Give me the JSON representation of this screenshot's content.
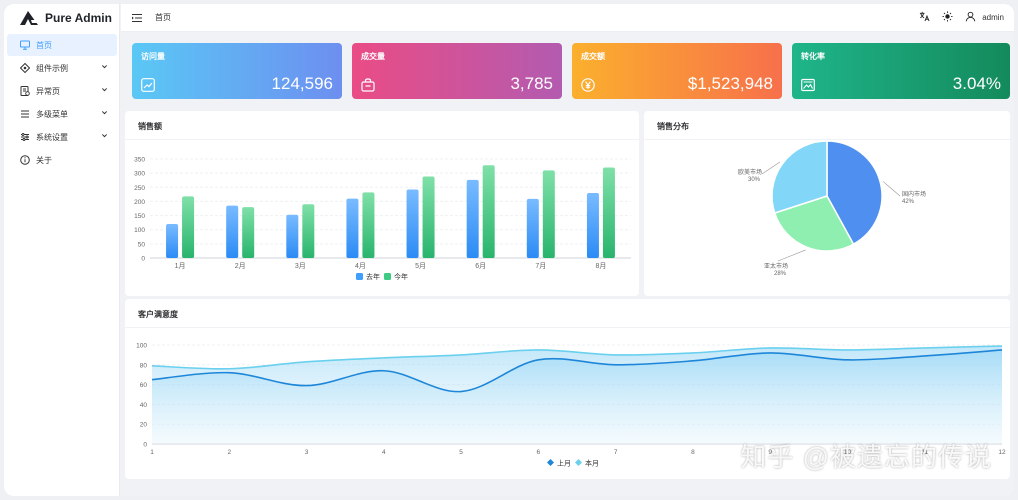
{
  "app": {
    "title": "Pure Admin"
  },
  "sidebar": {
    "items": [
      {
        "label": "首页",
        "icon": "monitor-icon",
        "active": true
      },
      {
        "label": "组件示例",
        "icon": "components-icon"
      },
      {
        "label": "异常页",
        "icon": "exception-icon"
      },
      {
        "label": "多级菜单",
        "icon": "menu-icon"
      },
      {
        "label": "系统设置",
        "icon": "settings-icon"
      },
      {
        "label": "关于",
        "icon": "info-icon"
      }
    ]
  },
  "topbar": {
    "breadcrumb": "首页",
    "user": "admin"
  },
  "stats": [
    {
      "title": "访问量",
      "value": "124,596",
      "icon": "chart-icon",
      "colors": [
        "#5ac8f5",
        "#6d8ff0"
      ]
    },
    {
      "title": "成交量",
      "value": "3,785",
      "icon": "bag-icon",
      "colors": [
        "#ea4c85",
        "#b35bb0"
      ]
    },
    {
      "title": "成交额",
      "value": "$1,523,948",
      "icon": "yen-icon",
      "colors": [
        "#fbb02d",
        "#f7704b"
      ]
    },
    {
      "title": "转化率",
      "value": "3.04%",
      "icon": "image-icon",
      "colors": [
        "#1fb58a",
        "#148a5c"
      ]
    }
  ],
  "sales_card": {
    "title": "销售额"
  },
  "pie_card": {
    "title": "销售分布"
  },
  "satisfaction_card": {
    "title": "客户满意度"
  },
  "watermark": "知乎 @被遗忘的传说",
  "chart_data": [
    {
      "type": "bar",
      "title": "销售额",
      "categories": [
        "1月",
        "2月",
        "3月",
        "4月",
        "5月",
        "6月",
        "7月",
        "8月"
      ],
      "series": [
        {
          "name": "去年",
          "values": [
            120,
            185,
            153,
            210,
            242,
            276,
            209,
            230
          ],
          "color": "#409eff"
        },
        {
          "name": "今年",
          "values": [
            218,
            180,
            190,
            232,
            288,
            328,
            310,
            320
          ],
          "color": "#3ecb83"
        }
      ],
      "ylim": [
        0,
        350
      ],
      "yticks": [
        0,
        50,
        100,
        150,
        200,
        250,
        300,
        350
      ],
      "legend": "bottom",
      "grid": true
    },
    {
      "type": "pie",
      "title": "销售分布",
      "slices": [
        {
          "name": "国内市场",
          "value": 42,
          "label": "42%",
          "color": "#4e8ff0"
        },
        {
          "name": "亚太市场",
          "value": 28,
          "label": "28%",
          "color": "#8fefb0"
        },
        {
          "name": "欧美市场",
          "value": 30,
          "label": "30%",
          "color": "#82d6f8"
        }
      ]
    },
    {
      "type": "line",
      "title": "客户满意度",
      "x": [
        1,
        2,
        3,
        4,
        5,
        6,
        7,
        8,
        9,
        10,
        11,
        12
      ],
      "series": [
        {
          "name": "上月",
          "values": [
            65,
            72,
            59,
            74,
            53,
            85,
            80,
            84,
            92,
            85,
            89,
            95
          ],
          "color": "#1e86d8"
        },
        {
          "name": "本月",
          "values": [
            79,
            76,
            83,
            87,
            90,
            95,
            90,
            92,
            97,
            95,
            97,
            99
          ],
          "color": "#6ad0ee"
        }
      ],
      "ylim": [
        0,
        100
      ],
      "yticks": [
        0,
        20,
        40,
        60,
        80,
        100
      ],
      "legend": "bottom",
      "grid": true
    }
  ]
}
